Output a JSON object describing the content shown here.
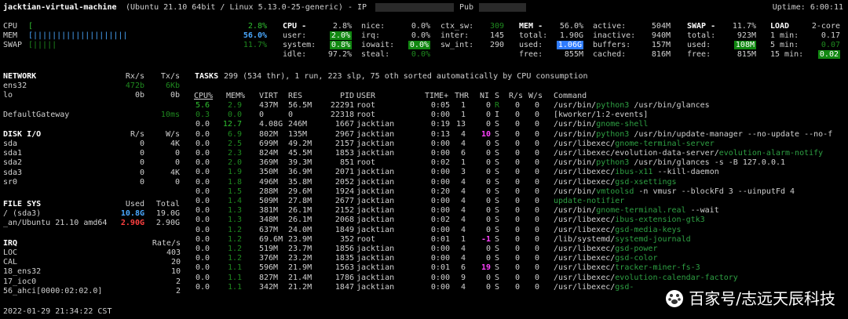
{
  "header": {
    "host": "jacktian-virtual-machine",
    "os": "(Ubuntu 21.10 64bit / Linux 5.13.0-25-generic) - IP",
    "pub": "Pub",
    "uptime": "Uptime: 6:00:11"
  },
  "quicklook": {
    "cpu_label": "CPU",
    "cpu_val": "2.8%",
    "mem_label": "MEM",
    "mem_bar": "[||||||||||||||||||||",
    "mem_val": "56.0%",
    "swap_label": "SWAP",
    "swap_bar": "[|||||",
    "swap_val": "11.7%",
    "cpu_bar": "["
  },
  "cpu": {
    "title": "CPU -",
    "total": "2.8%",
    "user_label": "user:",
    "user": "2.0%",
    "system_label": "system:",
    "system": "0.8%",
    "idle_label": "idle:",
    "idle": "97.2%",
    "nice_label": "nice:",
    "nice": "0.0%",
    "irq_label": "irq:",
    "irq": "0.0%",
    "iowait_label": "iowait:",
    "iowait": "0.0%",
    "steal_label": "steal:",
    "steal": "0.0%",
    "ctx_label": "ctx_sw:",
    "ctx": "309",
    "inter_label": "inter:",
    "inter": "145",
    "swint_label": "sw_int:",
    "swint": "290"
  },
  "mem": {
    "title": "MEM -",
    "pct": "56.0%",
    "total_label": "total:",
    "total": "1.90G",
    "used_label": "used:",
    "used": "1.06G",
    "free_label": "free:",
    "free": "855M",
    "active_label": "active:",
    "active": "504M",
    "inactive_label": "inactive:",
    "inactive": "940M",
    "buffers_label": "buffers:",
    "buffers": "157M",
    "cached_label": "cached:",
    "cached": "816M"
  },
  "swap": {
    "title": "SWAP -",
    "pct": "11.7%",
    "total_label": "total:",
    "total": "923M",
    "used_label": "used:",
    "used": "108M",
    "free_label": "free:",
    "free": "815M"
  },
  "load": {
    "title": "LOAD",
    "cores": "2-core",
    "m1_label": "1 min:",
    "m1": "0.17",
    "m5_label": "5 min:",
    "m5": "0.07",
    "m15_label": "15 min:",
    "m15": "0.02"
  },
  "network": {
    "title": "NETWORK",
    "rx": "Rx/s",
    "tx": "Tx/s",
    "rows": [
      {
        "name": "ens32",
        "rx": "472b",
        "tx": "6Kb"
      },
      {
        "name": "lo",
        "rx": "0b",
        "tx": "0b"
      },
      {
        "name": "",
        "rx": "",
        "tx": ""
      },
      {
        "name": "DefaultGateway",
        "rx": "",
        "tx": "10ms"
      }
    ]
  },
  "disk": {
    "title": "DISK I/O",
    "r": "R/s",
    "w": "W/s",
    "rows": [
      {
        "name": "sda",
        "r": "0",
        "w": "4K"
      },
      {
        "name": "sda1",
        "r": "0",
        "w": "0"
      },
      {
        "name": "sda2",
        "r": "0",
        "w": "0"
      },
      {
        "name": "sda3",
        "r": "0",
        "w": "4K"
      },
      {
        "name": "sr0",
        "r": "0",
        "w": "0"
      }
    ]
  },
  "fs": {
    "title": "FILE SYS",
    "used": "Used",
    "total": "Total",
    "rows": [
      {
        "name": "/ (sda3)",
        "used": "10.8G",
        "total": "19.0G"
      },
      {
        "name": "_an/Ubuntu 21.10 amd64",
        "used": "2.90G",
        "total": "2.90G"
      }
    ]
  },
  "irq": {
    "title": "IRQ",
    "rate": "Rate/s",
    "rows": [
      {
        "name": "LOC",
        "rate": "403"
      },
      {
        "name": "CAL",
        "rate": "20"
      },
      {
        "name": "18_ens32",
        "rate": "10"
      },
      {
        "name": "17_ioc0",
        "rate": "2"
      },
      {
        "name": "56_ahci[0000:02:02.0]",
        "rate": "2"
      }
    ]
  },
  "tasks": {
    "label": "TASKS",
    "summary": "299 (534 thr), 1 run, 223 slp, 75 oth sorted automatically by CPU consumption"
  },
  "proc_headers": [
    "CPU%",
    "MEM%",
    "VIRT",
    "RES",
    "PID",
    "USER",
    "TIME+",
    "THR",
    "NI",
    "S",
    "R/s",
    "W/s",
    "Command"
  ],
  "processes": [
    {
      "cpu": "5.6",
      "mem": "2.9",
      "virt": "437M",
      "res": "56.5M",
      "pid": "22291",
      "user": "root",
      "time": "0:05",
      "thr": "1",
      "ni": "0",
      "s": "R",
      "rs": "0",
      "ws": "0",
      "cmd_pre": "/usr/bin/",
      "cmd_hl": "python3",
      "cmd_post": " /usr/bin/glances"
    },
    {
      "cpu": "0.3",
      "mem": "0.0",
      "virt": "0",
      "res": "0",
      "pid": "22318",
      "user": "root",
      "time": "0:00",
      "thr": "1",
      "ni": "0",
      "s": "I",
      "rs": "0",
      "ws": "0",
      "cmd_pre": "[kworker/1:2-events]",
      "cmd_hl": "",
      "cmd_post": ""
    },
    {
      "cpu": "0.0",
      "mem": "12.7",
      "virt": "4.08G",
      "res": "246M",
      "pid": "1667",
      "user": "jacktian",
      "time": "0:19",
      "thr": "13",
      "ni": "0",
      "s": "S",
      "rs": "0",
      "ws": "0",
      "cmd_pre": "/usr/bin/",
      "cmd_hl": "gnome-shell",
      "cmd_post": ""
    },
    {
      "cpu": "0.0",
      "mem": "6.9",
      "virt": "802M",
      "res": "135M",
      "pid": "2967",
      "user": "jacktian",
      "time": "0:13",
      "thr": "4",
      "ni": "10",
      "s": "S",
      "rs": "0",
      "ws": "0",
      "cmd_pre": "/usr/bin/",
      "cmd_hl": "python3",
      "cmd_post": " /usr/bin/update-manager --no-update --no-f"
    },
    {
      "cpu": "0.0",
      "mem": "2.5",
      "virt": "699M",
      "res": "49.2M",
      "pid": "2157",
      "user": "jacktian",
      "time": "0:00",
      "thr": "4",
      "ni": "0",
      "s": "S",
      "rs": "0",
      "ws": "0",
      "cmd_pre": "/usr/libexec/",
      "cmd_hl": "gnome-terminal-server",
      "cmd_post": ""
    },
    {
      "cpu": "0.0",
      "mem": "2.3",
      "virt": "824M",
      "res": "45.5M",
      "pid": "1853",
      "user": "jacktian",
      "time": "0:00",
      "thr": "6",
      "ni": "0",
      "s": "S",
      "rs": "0",
      "ws": "0",
      "cmd_pre": "/usr/libexec/evolution-data-server/",
      "cmd_hl": "evolution-alarm-notify",
      "cmd_post": ""
    },
    {
      "cpu": "0.0",
      "mem": "2.0",
      "virt": "369M",
      "res": "39.3M",
      "pid": "851",
      "user": "root",
      "time": "0:02",
      "thr": "1",
      "ni": "0",
      "s": "S",
      "rs": "0",
      "ws": "0",
      "cmd_pre": "/usr/bin/",
      "cmd_hl": "python3",
      "cmd_post": " /usr/bin/glances -s -B 127.0.0.1"
    },
    {
      "cpu": "0.0",
      "mem": "1.9",
      "virt": "350M",
      "res": "36.9M",
      "pid": "2071",
      "user": "jacktian",
      "time": "0:00",
      "thr": "3",
      "ni": "0",
      "s": "S",
      "rs": "0",
      "ws": "0",
      "cmd_pre": "/usr/libexec/",
      "cmd_hl": "ibus-x11",
      "cmd_post": " --kill-daemon"
    },
    {
      "cpu": "0.0",
      "mem": "1.8",
      "virt": "496M",
      "res": "35.8M",
      "pid": "2052",
      "user": "jacktian",
      "time": "0:00",
      "thr": "4",
      "ni": "0",
      "s": "S",
      "rs": "0",
      "ws": "0",
      "cmd_pre": "/usr/libexec/",
      "cmd_hl": "gsd-xsettings",
      "cmd_post": ""
    },
    {
      "cpu": "0.0",
      "mem": "1.5",
      "virt": "288M",
      "res": "29.6M",
      "pid": "1924",
      "user": "jacktian",
      "time": "0:20",
      "thr": "4",
      "ni": "0",
      "s": "S",
      "rs": "0",
      "ws": "0",
      "cmd_pre": "/usr/bin/",
      "cmd_hl": "vmtoolsd",
      "cmd_post": " -n vmusr --blockFd 3 --uinputFd 4"
    },
    {
      "cpu": "0.0",
      "mem": "1.4",
      "virt": "509M",
      "res": "27.8M",
      "pid": "2677",
      "user": "jacktian",
      "time": "0:00",
      "thr": "4",
      "ni": "0",
      "s": "S",
      "rs": "0",
      "ws": "0",
      "cmd_pre": "",
      "cmd_hl": "update-notifier",
      "cmd_post": ""
    },
    {
      "cpu": "0.0",
      "mem": "1.3",
      "virt": "381M",
      "res": "26.1M",
      "pid": "2152",
      "user": "jacktian",
      "time": "0:00",
      "thr": "4",
      "ni": "0",
      "s": "S",
      "rs": "0",
      "ws": "0",
      "cmd_pre": "/usr/bin/",
      "cmd_hl": "gnome-terminal.real",
      "cmd_post": " --wait"
    },
    {
      "cpu": "0.0",
      "mem": "1.3",
      "virt": "348M",
      "res": "26.1M",
      "pid": "2068",
      "user": "jacktian",
      "time": "0:02",
      "thr": "4",
      "ni": "0",
      "s": "S",
      "rs": "0",
      "ws": "0",
      "cmd_pre": "/usr/libexec/",
      "cmd_hl": "ibus-extension-gtk3",
      "cmd_post": ""
    },
    {
      "cpu": "0.0",
      "mem": "1.2",
      "virt": "637M",
      "res": "24.0M",
      "pid": "1849",
      "user": "jacktian",
      "time": "0:00",
      "thr": "4",
      "ni": "0",
      "s": "S",
      "rs": "0",
      "ws": "0",
      "cmd_pre": "/usr/libexec/",
      "cmd_hl": "gsd-media-keys",
      "cmd_post": ""
    },
    {
      "cpu": "0.0",
      "mem": "1.2",
      "virt": "69.6M",
      "res": "23.9M",
      "pid": "352",
      "user": "root",
      "time": "0:01",
      "thr": "1",
      "ni": "-1",
      "s": "S",
      "rs": "0",
      "ws": "0",
      "cmd_pre": "/lib/systemd/",
      "cmd_hl": "systemd-journald",
      "cmd_post": ""
    },
    {
      "cpu": "0.0",
      "mem": "1.2",
      "virt": "519M",
      "res": "23.7M",
      "pid": "1856",
      "user": "jacktian",
      "time": "0:00",
      "thr": "4",
      "ni": "0",
      "s": "S",
      "rs": "0",
      "ws": "0",
      "cmd_pre": "/usr/libexec/",
      "cmd_hl": "gsd-power",
      "cmd_post": ""
    },
    {
      "cpu": "0.0",
      "mem": "1.2",
      "virt": "376M",
      "res": "23.2M",
      "pid": "1835",
      "user": "jacktian",
      "time": "0:00",
      "thr": "4",
      "ni": "0",
      "s": "S",
      "rs": "0",
      "ws": "0",
      "cmd_pre": "/usr/libexec/",
      "cmd_hl": "gsd-color",
      "cmd_post": ""
    },
    {
      "cpu": "0.0",
      "mem": "1.1",
      "virt": "596M",
      "res": "21.9M",
      "pid": "1563",
      "user": "jacktian",
      "time": "0:01",
      "thr": "6",
      "ni": "19",
      "s": "S",
      "rs": "0",
      "ws": "0",
      "cmd_pre": "/usr/libexec/",
      "cmd_hl": "tracker-miner-fs-3",
      "cmd_post": ""
    },
    {
      "cpu": "0.0",
      "mem": "1.1",
      "virt": "827M",
      "res": "21.4M",
      "pid": "1786",
      "user": "jacktian",
      "time": "0:00",
      "thr": "9",
      "ni": "0",
      "s": "S",
      "rs": "0",
      "ws": "0",
      "cmd_pre": "/usr/libexec/",
      "cmd_hl": "evolution-calendar-factory",
      "cmd_post": ""
    },
    {
      "cpu": "0.0",
      "mem": "1.1",
      "virt": "342M",
      "res": "21.2M",
      "pid": "1847",
      "user": "jacktian",
      "time": "0:00",
      "thr": "4",
      "ni": "0",
      "s": "S",
      "rs": "0",
      "ws": "0",
      "cmd_pre": "/usr/libexec/",
      "cmd_hl": "gsd-",
      "cmd_post": ""
    }
  ],
  "footer": {
    "datetime": "2022-01-29 21:34:22 CST"
  },
  "watermark": {
    "text": "百家号/志远天辰科技"
  }
}
